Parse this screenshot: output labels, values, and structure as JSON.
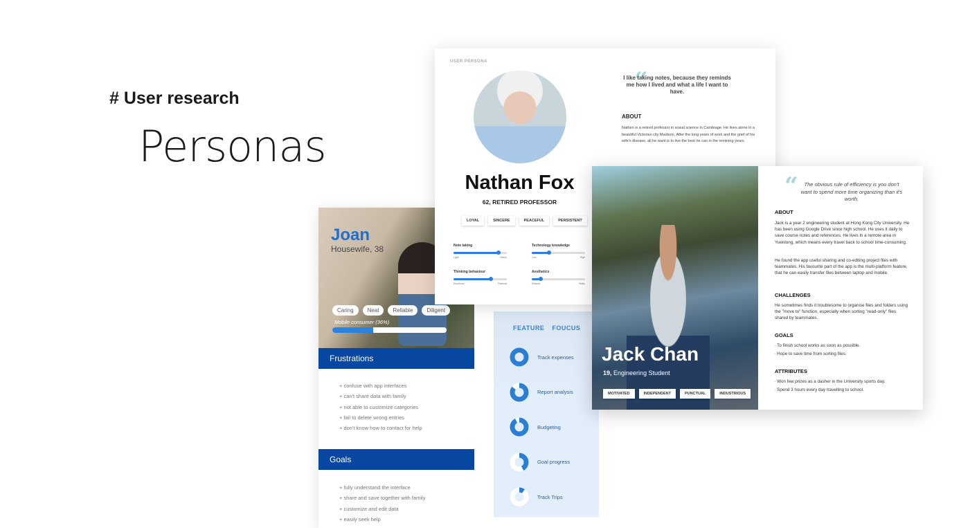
{
  "heading": {
    "tag": "# User research",
    "title": "Personas"
  },
  "joan": {
    "name": "Joan",
    "subtitle": "Housewife, 38",
    "traits": [
      "Caring",
      "Neat",
      "Reliable",
      "Diligent"
    ],
    "consumer_label": "Mobile consumer (36%)",
    "consumer_percent": 36,
    "frustrations_title": "Frustrations",
    "frustrations": [
      "+ confuse with app interfaces",
      "+ can't share data with family",
      "+ not able to customize categories",
      "+ fail to delete wrong entries",
      "+ don't know how to contact for help"
    ],
    "goals_title": "Goals",
    "goals": [
      "+ fully understand the interface",
      "+ share and save together with family",
      "+ customize and edit data",
      "+ easily seek help"
    ]
  },
  "feature_focus": {
    "title": "FEATURE FOUCUS",
    "color": "#2a7fd4",
    "items": [
      {
        "label": "Track expenses",
        "fraction": 1.0
      },
      {
        "label": "Report analysis",
        "fraction": 0.85
      },
      {
        "label": "Budgeting",
        "fraction": 0.92
      },
      {
        "label": "Goal progress",
        "fraction": 0.42
      },
      {
        "label": "Track Trips",
        "fraction": 0.1
      }
    ]
  },
  "nathan": {
    "label": "USER PERSONA",
    "name": "Nathan Fox",
    "age_role": "62, RETIRED PROFESSOR",
    "traits": [
      "LOYAL",
      "SINCERE",
      "PEACEFUL",
      "PERSISTENT"
    ],
    "quote": "I like taking notes, because they reminds me how I lived and what a life I want to have.",
    "about_title": "ABOUT",
    "about": "Nathen is a retired professor in sosial science in Cambrage. He lives alone in a beautiful Victorian city Madison. After the long years of work and the grief of his wife's disease, all he want is to live the best he can in the remining years.",
    "sliders": [
      {
        "label": "Note taking",
        "min": "Light",
        "max": "Heavy",
        "value": 0.85
      },
      {
        "label": "Technology knowledge",
        "min": "Low",
        "max": "High",
        "value": 0.33
      },
      {
        "label": "Thinking behaviour",
        "min": "Emotional",
        "max": "Rational",
        "value": 0.7
      },
      {
        "label": "Aesthetics",
        "min": "Minimal",
        "max": "Bulky",
        "value": 0.17
      }
    ]
  },
  "jack": {
    "name": "Jack Chan",
    "age": "19,",
    "role": "Engineering Student",
    "traits": [
      "MOTIVATED",
      "INDEPENDENT",
      "PUNCTUAL",
      "INDUSTRIOUS"
    ],
    "quote": "The obvious rule of efficiency is you don't want to spend more time organizing than it's worth.",
    "about_title": "ABOUT",
    "about1": "Jack is a year 2 engineering student at Hong Kong City University. He has been using Google Drive since high school. He uses it daily to save course notes and references. He lives in a remote area in Yuenlong, which means every travel back to school time-consuming.",
    "about2": "He found the app useful sharing and co-editing project files with teammates. His favourite part of the app is the multi-platform feature, that he can easily transfer files between laptop and mobile.",
    "challenges_title": "CHALLENGES",
    "challenges": "He sometimes finds it troublesome to organise files and folders using the \"move to\" function, especially when sorting \"read-only\" files shared by teammates.",
    "goals_title": "GOALS",
    "goals": [
      "To finish school works as soon as possible.",
      "Hope to save time from sorting files."
    ],
    "attributes_title": "ATTRIBUTES",
    "attributes": [
      "Won few prizes as a dasher in the University sports day.",
      "Spend 3 hours every day travelling to school."
    ]
  }
}
